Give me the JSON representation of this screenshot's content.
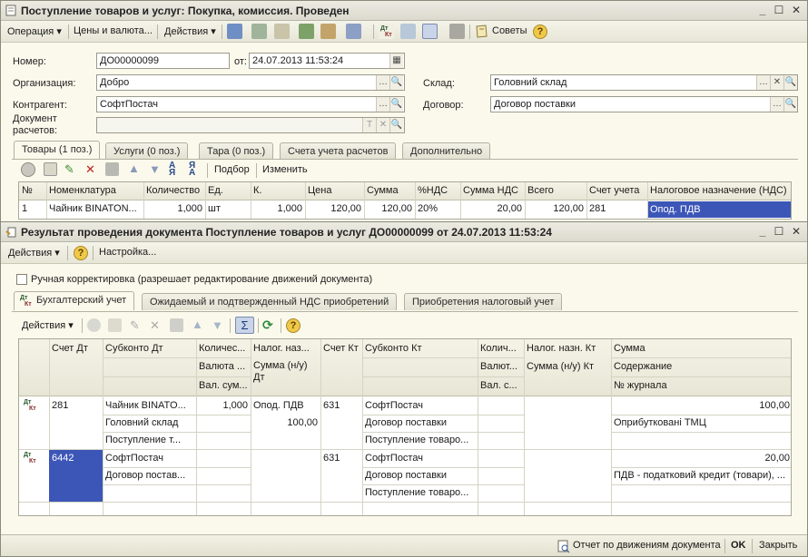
{
  "doc_window": {
    "title": "Поступление товаров и услуг: Покупка, комиссия. Проведен",
    "toolbar": {
      "operation": "Операция",
      "prices": "Цены и валюта...",
      "actions": "Действия",
      "advice": "Советы"
    },
    "number_label": "Номер:",
    "number_value": "ДО00000099",
    "date_label": "от:",
    "date_value": "24.07.2013 11:53:24",
    "org_label": "Организация:",
    "org_value": "Добро",
    "warehouse_label": "Склад:",
    "warehouse_value": "Головний склад",
    "contractor_label": "Контрагент:",
    "contractor_value": "СофтПостач",
    "contract_label": "Договор:",
    "contract_value": "Договор поставки",
    "settlement_label_1": "Документ",
    "settlement_label_2": "расчетов:",
    "tabs": [
      "Товары (1 поз.)",
      "Услуги (0 поз.)",
      "Тара (0 поз.)",
      "Счета учета расчетов",
      "Дополнительно"
    ],
    "grid_toolbar": {
      "pick": "Подбор",
      "change": "Изменить"
    },
    "columns": [
      "№",
      "Номенклатура",
      "Количество",
      "Ед.",
      "К.",
      "Цена",
      "Сумма",
      "%НДС",
      "Сумма НДС",
      "Всего",
      "Счет учета",
      "Налоговое назначение (НДС)"
    ],
    "row": [
      "1",
      "Чайник BINATON...",
      "1,000",
      "шт",
      "1,000",
      "120,00",
      "120,00",
      "20%",
      "20,00",
      "120,00",
      "281",
      "Опод. ПДВ"
    ]
  },
  "result_window": {
    "title": "Результат проведения документа Поступление товаров и услуг ДО00000099 от 24.07.2013 11:53:24",
    "toolbar": {
      "actions": "Действия",
      "settings": "Настройка..."
    },
    "manual_label": "Ручная корректировка (разрешает редактирование движений документа)",
    "tabs": [
      "Бухгалтерский учет",
      "Ожидаемый и подтвержденный НДС приобретений",
      "Приобретения налоговый учет"
    ],
    "grid_actions": "Действия",
    "headers": {
      "r1": [
        "Счет Дт",
        "Субконто Дт",
        "Количес...",
        "Налог. наз...",
        "Счет Кт",
        "Субконто Кт",
        "Колич...",
        "Налог. назн. Кт",
        "Сумма"
      ],
      "r2": [
        "Валюта ...",
        "Сумма (н/у) Дт",
        "Валют...",
        "Сумма (н/у) Кт",
        "Содержание"
      ],
      "r3": [
        "Вал. сум...",
        "Вал. с...",
        "№ журнала"
      ]
    },
    "entries": [
      {
        "dt_account": "281",
        "dt_sub": [
          "Чайник BINATO...",
          "Головний склад",
          "Поступление т..."
        ],
        "qty": "1,000",
        "tax_purpose": "Опод. ПДВ",
        "sum_nu_dt": "100,00",
        "kt_account": "631",
        "kt_sub": [
          "СофтПостач",
          "Договор поставки",
          "Поступление товаро..."
        ],
        "sum": "100,00",
        "content": "Оприбутковані ТМЦ"
      },
      {
        "dt_account": "6442",
        "dt_sub": [
          "СофтПостач",
          "Договор постав..."
        ],
        "kt_account": "631",
        "kt_sub": [
          "СофтПостач",
          "Договор поставки",
          "Поступление товаро..."
        ],
        "sum": "20,00",
        "content": "ПДВ - податковий кредит (товари), ..."
      }
    ],
    "status": {
      "report": "Отчет по движениям документа",
      "ok": "OK",
      "close": "Закрыть"
    }
  },
  "dtkt_icon": {
    "top": "Дт",
    "bottom": "Кт"
  }
}
